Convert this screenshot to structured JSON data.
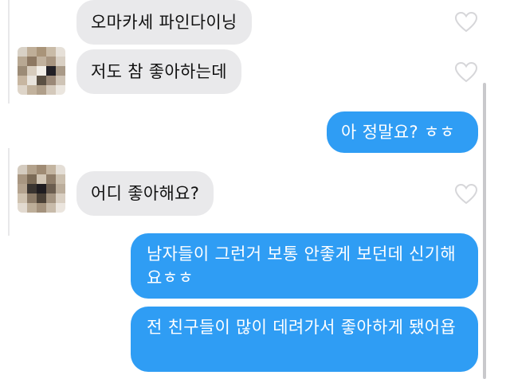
{
  "conversation": {
    "messages": [
      {
        "side": "received",
        "text": "오마카세 파인다이닝"
      },
      {
        "side": "received",
        "text": "저도 참 좋아하는데"
      },
      {
        "side": "sent",
        "text": "아 정말요? ㅎㅎ"
      },
      {
        "side": "received",
        "text": "어디 좋아해요?"
      },
      {
        "side": "sent",
        "text": "남자들이 그런거 보통 안좋게 보던데 신기해요ㅎㅎ"
      },
      {
        "side": "sent",
        "text": "전 친구들이 많이 데려가서 좋아하게 됐어욥"
      }
    ]
  },
  "icons": {
    "like": "heart-outline-icon"
  },
  "colors": {
    "sent_bubble": "#2f9df4",
    "received_bubble": "#e9e9eb",
    "heart_outline": "#d6d6d9"
  }
}
